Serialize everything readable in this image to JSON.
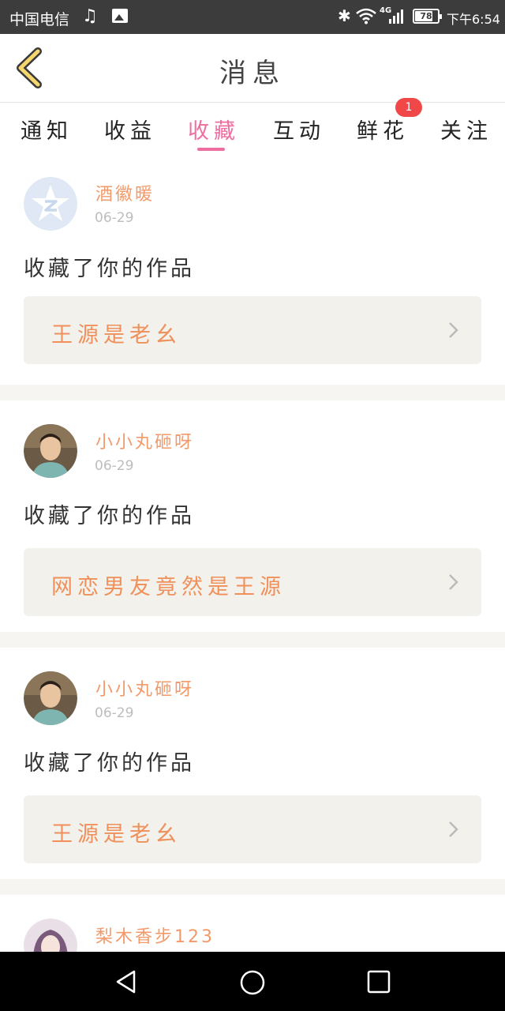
{
  "status": {
    "carrier": "中国电信",
    "battery": "78",
    "time": "下午6:54",
    "network": "4G",
    "icons": [
      "music-note-icon",
      "image-icon",
      "bluetooth-icon",
      "wifi-icon",
      "signal-icon",
      "battery-icon"
    ]
  },
  "header": {
    "title": "消息",
    "back_icon": "chevron-left-icon"
  },
  "tabs": {
    "items": [
      {
        "label": "通知"
      },
      {
        "label": "收益"
      },
      {
        "label": "收藏",
        "active": true
      },
      {
        "label": "互动"
      },
      {
        "label": "鲜花",
        "badge": "1"
      },
      {
        "label": "关注"
      }
    ]
  },
  "items": [
    {
      "user": "酒徽暖",
      "date": "06-29",
      "action": "收藏了你的作品",
      "work": "王源是老幺",
      "avatar": "default-star-avatar"
    },
    {
      "user": "小小丸砸呀",
      "date": "06-29",
      "action": "收藏了你的作品",
      "work": "网恋男友竟然是王源",
      "avatar": "user-photo-avatar"
    },
    {
      "user": "小小丸砸呀",
      "date": "06-29",
      "action": "收藏了你的作品",
      "work": "王源是老幺",
      "avatar": "user-photo-avatar"
    },
    {
      "user": "梨木香步123",
      "avatar": "anime-girl-avatar"
    }
  ],
  "navbar": {
    "icons": [
      "back-triangle-icon",
      "home-circle-icon",
      "recents-square-icon"
    ]
  },
  "colors": {
    "accent": "#ef6ea0",
    "username": "#f29a6a",
    "work_title": "#f0905a",
    "badge": "#f04848",
    "card_bg": "#f2f1ec"
  }
}
